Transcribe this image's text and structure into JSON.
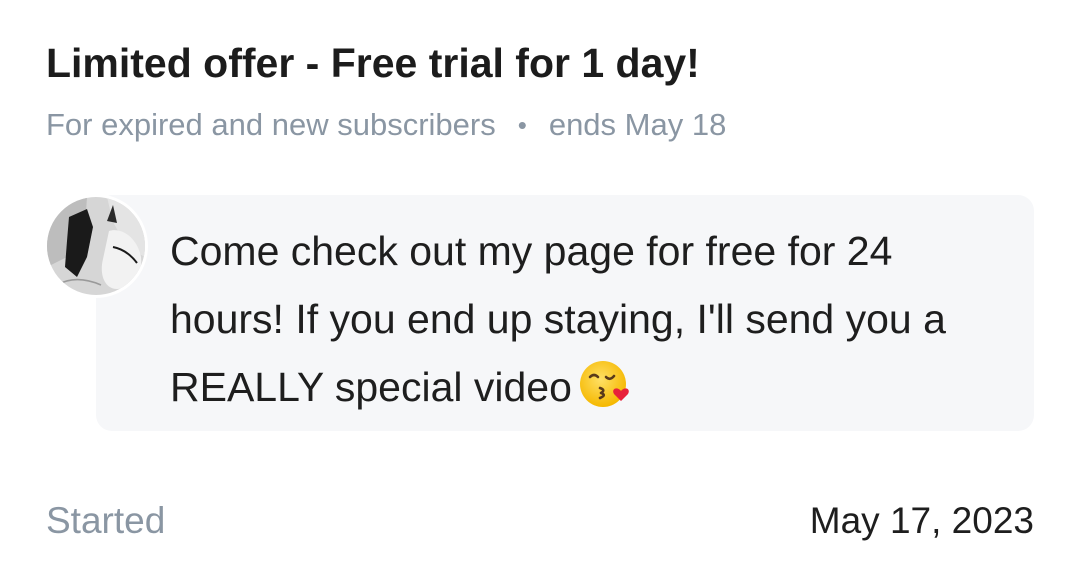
{
  "offer": {
    "title": "Limited offer - Free trial for 1 day!",
    "audience": "For expired and new subscribers",
    "separator": "•",
    "ends": "ends May 18"
  },
  "message": {
    "text": "Come check out my page for free for 24 hours! If you end up staying, I'll send you a REALLY special video",
    "emoji_icon": "kissing-face-with-heart-emoji"
  },
  "avatar": {
    "icon": "creator-avatar"
  },
  "status": {
    "label": "Started",
    "date": "May 17, 2023"
  }
}
